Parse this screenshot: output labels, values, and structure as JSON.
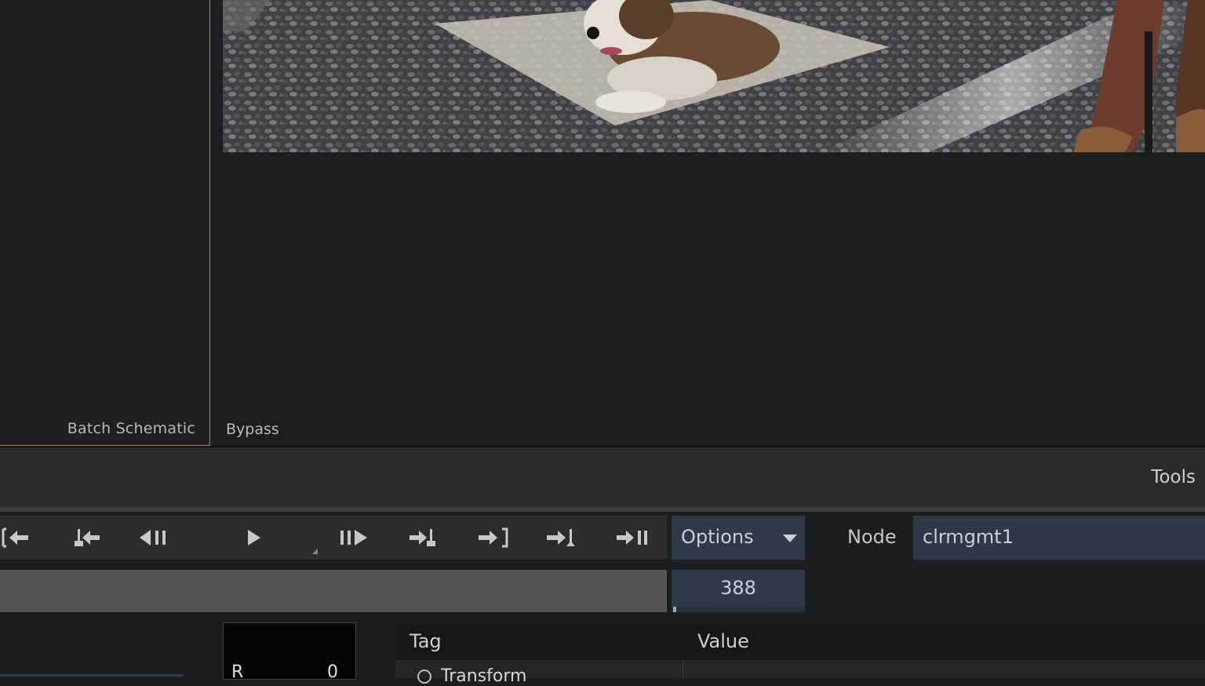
{
  "left_panel": {
    "label": "Batch Schematic"
  },
  "viewer": {
    "image": "dog-on-rug-photo",
    "bypass_label": "Bypass"
  },
  "tools": {
    "label": "Tools"
  },
  "transport": {
    "buttons": [
      {
        "name": "go-to-start-icon"
      },
      {
        "name": "previous-keyframe-icon"
      },
      {
        "name": "step-back-icon"
      },
      {
        "name": "play-icon"
      },
      {
        "name": "step-forward-icon"
      },
      {
        "name": "next-keyframe-icon"
      },
      {
        "name": "go-to-out-icon"
      },
      {
        "name": "go-to-mark-icon"
      },
      {
        "name": "go-to-end-icon"
      }
    ]
  },
  "options": {
    "label": "Options"
  },
  "node": {
    "label": "Node",
    "value": "clrmgmt1"
  },
  "frame": {
    "value": "388"
  },
  "swatch": {
    "channel": "R",
    "value": "0"
  },
  "tag_table": {
    "columns": {
      "tag": "Tag",
      "value": "Value"
    },
    "rows": [
      {
        "tag": "Transform"
      }
    ]
  },
  "colors": {
    "accent_border": "#b5835a",
    "field_bg": "#2f3a48"
  }
}
